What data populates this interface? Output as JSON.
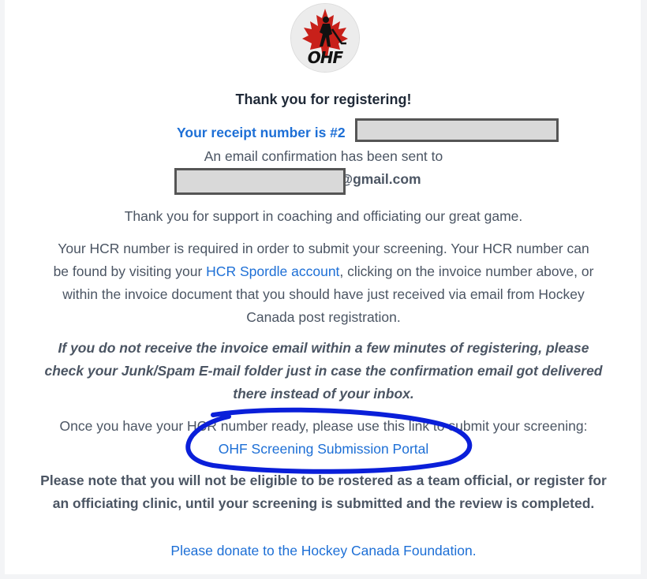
{
  "logo": {
    "text": "OHF",
    "icon": "maple-leaf-hockey-player-icon"
  },
  "heading": "Thank you for registering!",
  "receipt_label": "Your receipt number is #2",
  "email_notice": "An email confirmation has been sent to",
  "email_suffix": "@gmail.com",
  "support_text": "Thank you for support in coaching and officiating our great game.",
  "hcr_paragraph": {
    "line1": "Your HCR number is required in order to submit your screening. Your HCR number can",
    "line2_prefix": "be found by visiting your ",
    "line2_link": "HCR Spordle account",
    "line2_suffix": ", clicking on the invoice number above, or",
    "line3": "within the invoice document that you should have just received via email from Hockey",
    "line4": "Canada post registration."
  },
  "spam_note": {
    "line1": "If you do not receive the invoice email within a few minutes of registering, please",
    "line2": "check your Junk/Spam E-mail folder just in case the confirmation email got delivered",
    "line3": "there instead of your inbox."
  },
  "screening": {
    "instruction": "Once you have your HCR number ready, please use this link to submit your screening:",
    "link": "OHF Screening Submission Portal"
  },
  "eligibility_note": {
    "line1": "Please note that you will not be eligible to be rostered as a team official, or register for",
    "line2": "an officiating clinic, until your screening is submitted and the review is completed."
  },
  "donate_link": "Please donate to the Hockey Canada Foundation.",
  "colors": {
    "link": "#1d6fd6",
    "text": "#374151",
    "annotation": "#0a1fd9"
  }
}
